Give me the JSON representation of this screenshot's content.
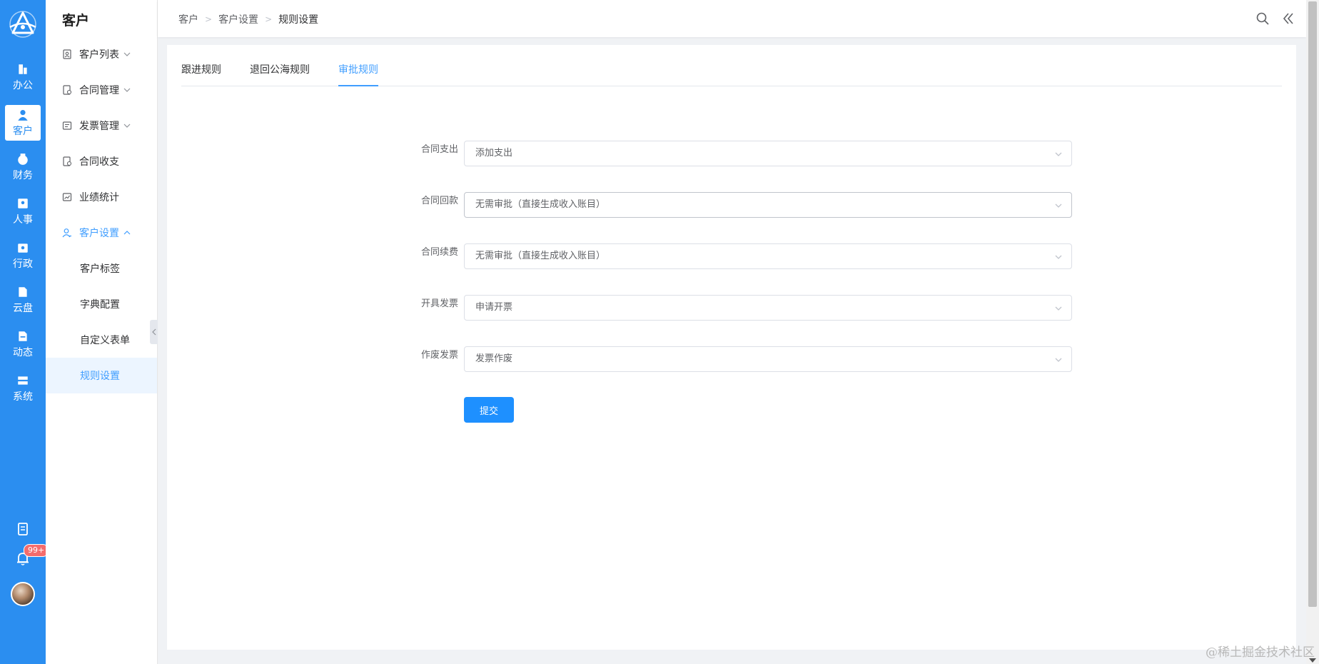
{
  "rail": {
    "items": [
      {
        "label": "办公",
        "icon": "office-icon"
      },
      {
        "label": "客户",
        "icon": "customer-icon"
      },
      {
        "label": "财务",
        "icon": "finance-icon"
      },
      {
        "label": "人事",
        "icon": "hr-icon"
      },
      {
        "label": "行政",
        "icon": "admin-icon"
      },
      {
        "label": "云盘",
        "icon": "cloud-disk-icon"
      },
      {
        "label": "动态",
        "icon": "feed-icon"
      },
      {
        "label": "系统",
        "icon": "system-icon"
      }
    ],
    "notification_badge": "99+",
    "accent_color": "#2b8ef0"
  },
  "sidebar": {
    "title": "客户",
    "items": [
      {
        "label": "客户列表"
      },
      {
        "label": "合同管理"
      },
      {
        "label": "发票管理"
      },
      {
        "label": "合同收支"
      },
      {
        "label": "业绩统计"
      },
      {
        "label": "客户设置"
      }
    ],
    "subitems": [
      {
        "label": "客户标签"
      },
      {
        "label": "字典配置"
      },
      {
        "label": "自定义表单"
      },
      {
        "label": "规则设置"
      }
    ]
  },
  "breadcrumb": [
    "客户",
    "客户设置",
    "规则设置"
  ],
  "tabs": [
    {
      "label": "跟进规则"
    },
    {
      "label": "退回公海规则"
    },
    {
      "label": "审批规则"
    }
  ],
  "form": {
    "fields": [
      {
        "label": "合同支出",
        "value": "添加支出"
      },
      {
        "label": "合同回款",
        "value": "无需审批（直接生成收入账目）"
      },
      {
        "label": "合同续费",
        "value": "无需审批（直接生成收入账目）"
      },
      {
        "label": "开具发票",
        "value": "申请开票"
      },
      {
        "label": "作废发票",
        "value": "发票作废"
      }
    ],
    "submit_label": "提交"
  },
  "watermark": "@稀土掘金技术社区"
}
